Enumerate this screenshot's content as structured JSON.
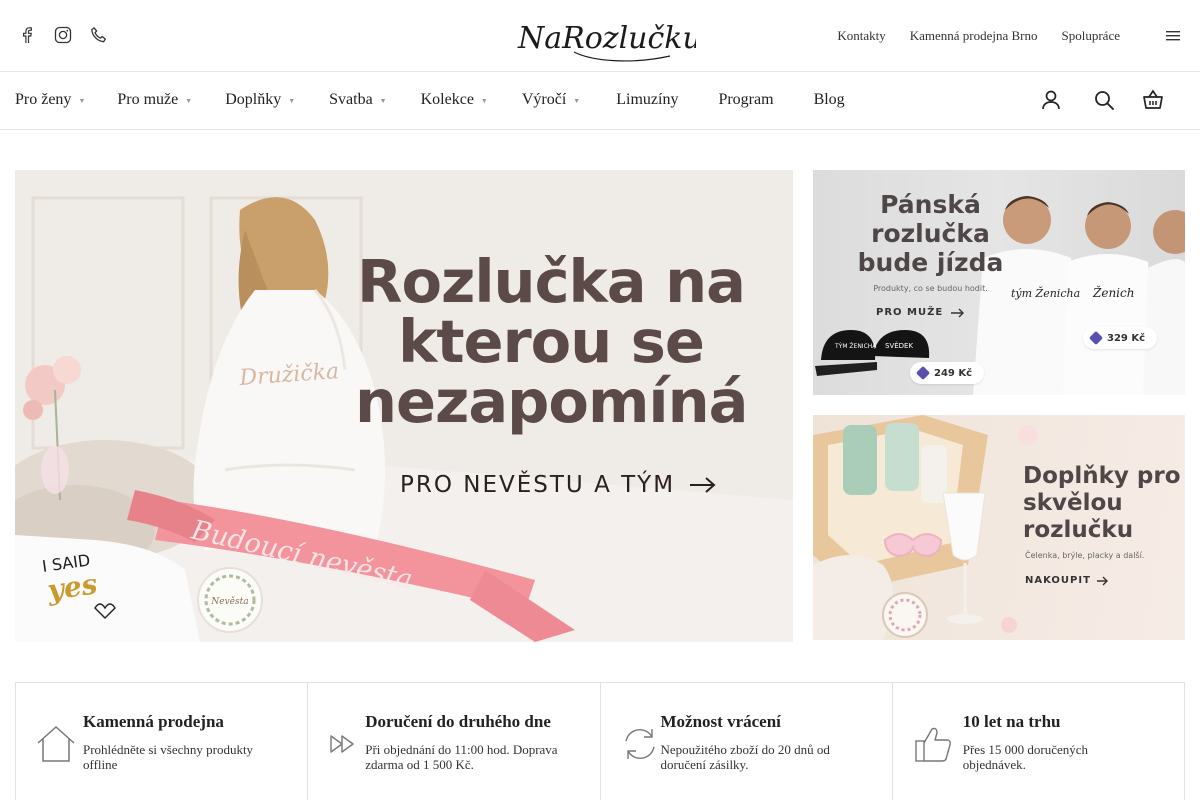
{
  "header": {
    "social": [
      {
        "icon": "facebook-icon"
      },
      {
        "icon": "instagram-icon"
      },
      {
        "icon": "phone-icon"
      }
    ],
    "logo_text": "NaRozlučku.cz",
    "links": [
      {
        "label": "Kontakty"
      },
      {
        "label": "Kamenná prodejna Brno"
      },
      {
        "label": "Spolupráce"
      }
    ],
    "menu_icon": "hamburger-menu-icon"
  },
  "nav": {
    "items": [
      {
        "label": "Pro ženy",
        "dropdown": true
      },
      {
        "label": "Pro muže",
        "dropdown": true
      },
      {
        "label": "Doplňky",
        "dropdown": true
      },
      {
        "label": "Svatba",
        "dropdown": true
      },
      {
        "label": "Kolekce",
        "dropdown": true
      },
      {
        "label": "Výročí",
        "dropdown": true
      },
      {
        "label": "Limuzíny",
        "dropdown": false
      },
      {
        "label": "Program",
        "dropdown": false
      },
      {
        "label": "Blog",
        "dropdown": false
      }
    ],
    "caret": "▼",
    "icons": [
      "user-icon",
      "search-icon",
      "basket-icon"
    ]
  },
  "hero": {
    "title": "Rozlučka na kterou se nezapomíná",
    "cta": "PRO NEVĚSTU A TÝM",
    "sash_text": "Budoucí nevěsta",
    "robe_text": "Družička",
    "shirt_text_1": "I SAID",
    "shirt_text_2": "yes",
    "badge_text": "Nevěsta"
  },
  "banner_men": {
    "title": "Pánská rozlučka bude jízda",
    "subtitle": "Produkty, co se budou hodit.",
    "cta": "PRO MUŽE",
    "price_1": "249 Kč",
    "price_2": "329 Kč",
    "shirt_1": "tým Ženicha",
    "shirt_2": "Ženich",
    "cap_1": "TÝM ŽENICHA",
    "cap_2": "SVĚDEK"
  },
  "banner_accessories": {
    "title": "Doplňky pro skvělou rozlučku",
    "subtitle": "Čelenka, brýle, placky a další.",
    "cta": "NAKOUPIT"
  },
  "features": [
    {
      "icon": "house-icon",
      "title": "Kamenná prodejna",
      "desc": "Prohlédněte si všechny produkty offline"
    },
    {
      "icon": "fast-forward-icon",
      "title": "Doručení do druhého dne",
      "desc": "Při objednání do 11:00 hod. Doprava zdarma od 1 500 Kč."
    },
    {
      "icon": "refresh-icon",
      "title": "Možnost vrácení",
      "desc": "Nepoužitého zboží do 20 dnů od doručení zásilky."
    },
    {
      "icon": "thumbs-up-icon",
      "title": "10 let na trhu",
      "desc": "Přes 15 000 doručených objednávek."
    }
  ],
  "colors": {
    "title_brown": "#5b4a48",
    "sash_pink": "#f08a94",
    "border_grey": "#e2e2e2",
    "price_tag_accent": "#5a4fb0"
  }
}
